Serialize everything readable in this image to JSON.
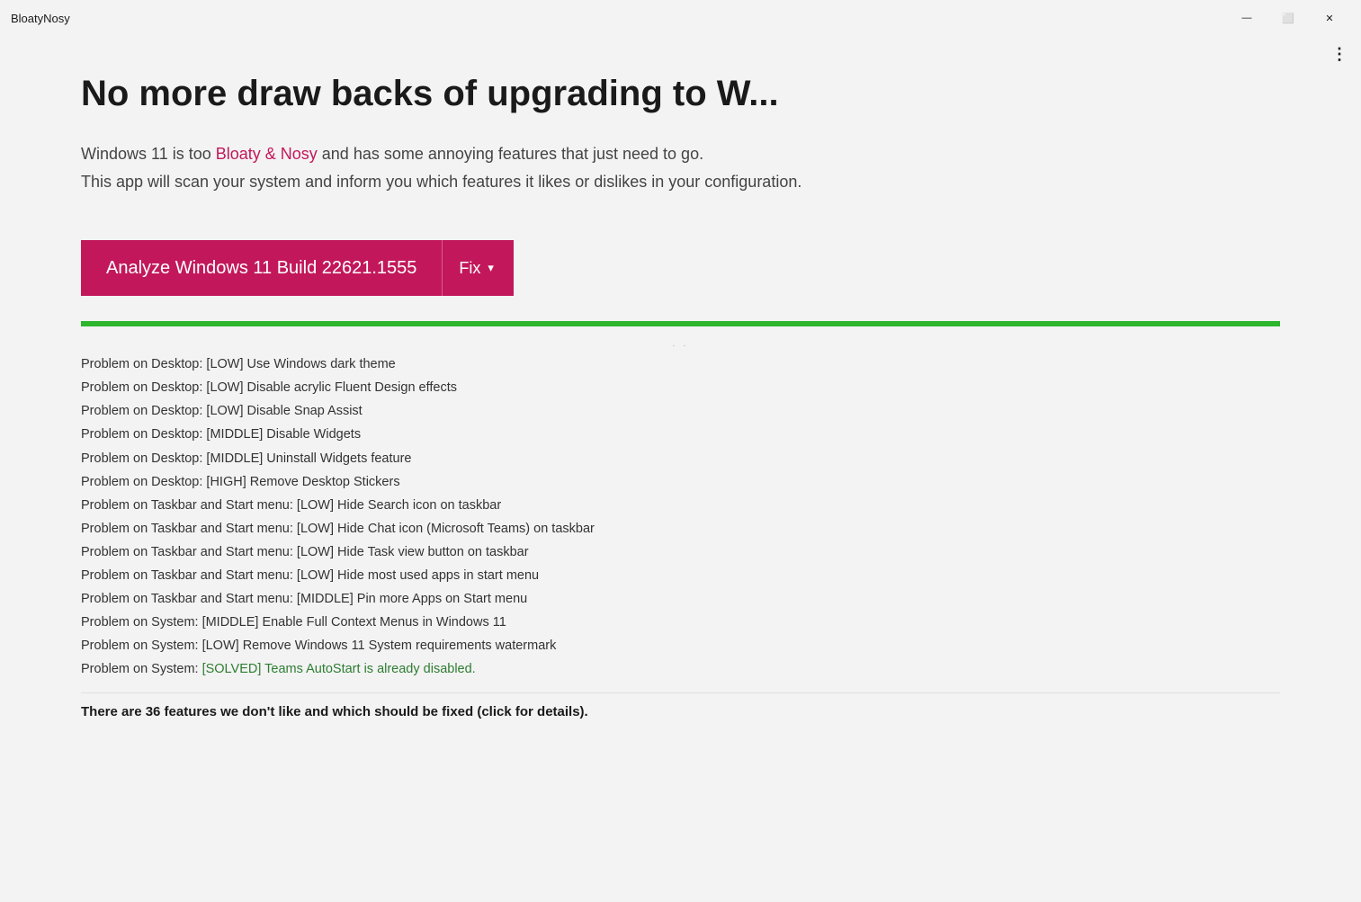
{
  "titleBar": {
    "appTitle": "BloatyNosy",
    "minimizeLabel": "—",
    "maximizeLabel": "⬜",
    "closeLabel": "✕",
    "moreOptionsLabel": "⋮"
  },
  "headline": {
    "text": "No more draw backs of upgrading to W..."
  },
  "subtitle": {
    "prefix": "Windows 11 is too ",
    "brand": "Bloaty & Nosy",
    "suffix": " and has some annoying features that just need to go.",
    "line2": "This app will scan your system and inform you which features it likes or dislikes in your configuration."
  },
  "actions": {
    "analyzeLabel": "Analyze Windows 11 Build 22621.1555",
    "fixLabel": "Fix"
  },
  "progressBar": {
    "percent": 100,
    "color": "#2db52d"
  },
  "results": [
    {
      "text": "Problem on Desktop: [LOW] Use Windows dark theme"
    },
    {
      "text": "Problem on Desktop: [LOW] Disable acrylic Fluent Design effects"
    },
    {
      "text": "Problem on Desktop: [LOW] Disable Snap Assist"
    },
    {
      "text": "Problem on Desktop: [MIDDLE] Disable Widgets"
    },
    {
      "text": "Problem on Desktop: [MIDDLE] Uninstall Widgets feature"
    },
    {
      "text": "Problem on Desktop: [HIGH] Remove Desktop Stickers"
    },
    {
      "text": "Problem on Taskbar and Start menu: [LOW] Hide Search icon on taskbar"
    },
    {
      "text": "Problem on Taskbar and Start menu: [LOW] Hide Chat icon (Microsoft Teams) on taskbar"
    },
    {
      "text": "Problem on Taskbar and Start menu: [LOW] Hide Task view button on taskbar"
    },
    {
      "text": "Problem on Taskbar and Start menu: [LOW] Hide most used apps in start menu"
    },
    {
      "text": "Problem on Taskbar and Start menu: [MIDDLE] Pin more Apps on Start menu"
    },
    {
      "text": "Problem on System: [MIDDLE] Enable Full Context Menus in Windows 11"
    },
    {
      "text": "Problem on System: [LOW] Remove Windows 11 System requirements watermark"
    },
    {
      "text": "Problem on System: [SOLVED] Teams AutoStart is already disabled.",
      "solved": true
    }
  ],
  "summary": {
    "text": "There are 36 features we don't like and which should be fixed (click for details)."
  }
}
